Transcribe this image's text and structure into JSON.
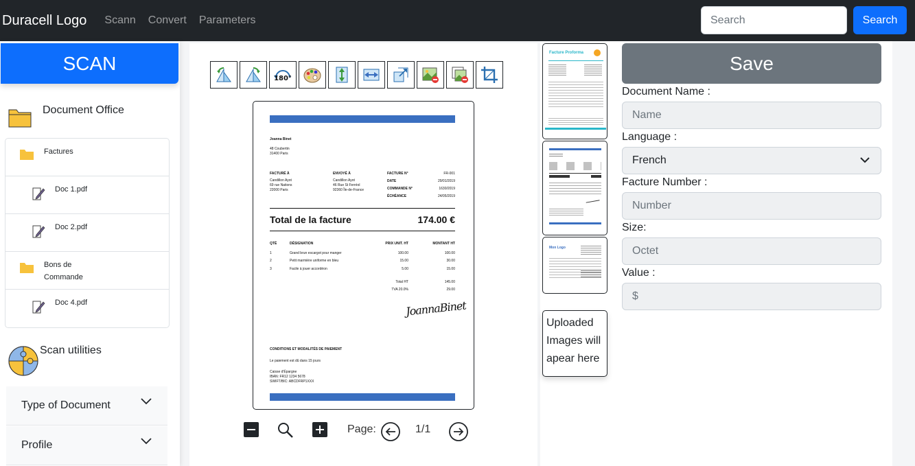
{
  "navbar": {
    "brand": "Duracell Logo",
    "links": [
      "Scann",
      "Convert",
      "Parameters"
    ],
    "search_placeholder": "Search",
    "search_button": "Search"
  },
  "sidebar": {
    "scan_button": "SCAN",
    "office_title": "Document Office",
    "tree": [
      {
        "type": "folder",
        "label": "Factures"
      },
      {
        "type": "doc",
        "label": "Doc 1.pdf"
      },
      {
        "type": "doc",
        "label": "Doc 2.pdf"
      },
      {
        "type": "folder",
        "label": "Bons de Commande"
      },
      {
        "type": "doc",
        "label": "Doc 4.pdf"
      }
    ],
    "utilities_title": "Scan utilities",
    "accordion": [
      "Type of Document",
      "Profile"
    ]
  },
  "viewer": {
    "toolbar_icons": [
      "rotate-left-icon",
      "rotate-right-icon",
      "rotate-180-icon",
      "color-palette-icon",
      "flip-vertical-icon",
      "flip-horizontal-icon",
      "resize-icon",
      "remove-image-icon",
      "delete-page-icon",
      "crop-icon"
    ],
    "rotate_180_text": "180°",
    "page_label": "Page:",
    "page_number": "1/1"
  },
  "invoice": {
    "name": "Joanna Binet",
    "address": [
      "48 Coubertin",
      "31400 Paris"
    ],
    "billed_to_h": "FACTURÉ À",
    "billed_to": [
      "Candillon Ayot",
      "69 rue Nations",
      "22000 Paris"
    ],
    "sent_to_h": "ENVOYÉ À",
    "sent_to": [
      "Candillon Ayot",
      "46 Rue St Ferréol",
      "92360 Île-de-France"
    ],
    "meta": [
      {
        "k": "FACTURE N°",
        "v": "FR-001"
      },
      {
        "k": "DATE",
        "v": "29/01/2019"
      },
      {
        "k": "COMMANDE N°",
        "v": "1630/2019"
      },
      {
        "k": "ÉCHÉANCE",
        "v": "24/05/2019"
      }
    ],
    "total_label": "Total de la facture",
    "total_value": "174.00 €",
    "columns": [
      "QTÉ",
      "DÉSIGNATION",
      "PRIX UNIT. HT",
      "MONTANT HT"
    ],
    "rows": [
      {
        "q": "1",
        "d": "Grand brun escargot pour manger",
        "p": "100.00",
        "m": "100.00"
      },
      {
        "q": "2",
        "d": "Petit marmière uniforme en bleu",
        "p": "15.00",
        "m": "30.00"
      },
      {
        "q": "3",
        "d": "Facile à jouer accordéon",
        "p": "5.00",
        "m": "15.00"
      }
    ],
    "total_ht_label": "Total HT",
    "total_ht": "145.00",
    "tva_label": "TVA 20.0%",
    "tva": "29.00",
    "signature": "JoannaBinet",
    "conditions_h": "CONDITIONS ET MODALITÉS DE PAIEMENT",
    "conditions_1": "Le paiement est dû dans 15 jours",
    "bank": [
      "Caisse d'Épargne",
      "IBAN: FR12 1234 5678",
      "SWIFT/BIC: ABCDFRP1XXX"
    ]
  },
  "thumbnails": {
    "thumb1_title": "Facture Proforma",
    "thumb3_logo": "Mon Logo",
    "upload_note": "Uploaded Images will apear here"
  },
  "form": {
    "save_button": "Save",
    "doc_name_label": "Document Name :",
    "doc_name_placeholder": "Name",
    "language_label": "Language :",
    "language_value": "French",
    "facture_label": "Facture Number :",
    "facture_placeholder": "Number",
    "size_label": "Size:",
    "size_placeholder": "Octet",
    "value_label": "Value :",
    "value_placeholder": "$"
  },
  "colors": {
    "navbar_bg": "#212529",
    "primary": "#0d6efd",
    "secondary": "#6c757d",
    "invoice_accent": "#3a6fc0",
    "folder": "#f7c23c",
    "thumb_accent": "#29b6c9"
  }
}
